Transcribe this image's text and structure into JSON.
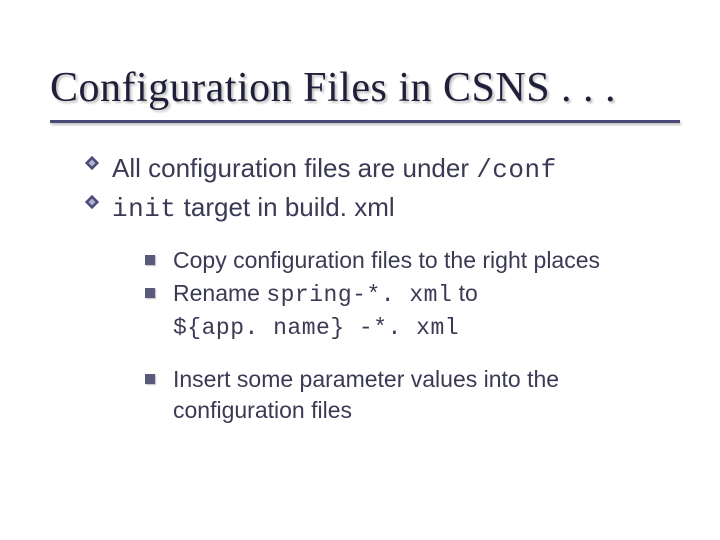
{
  "title": "Configuration Files in CSNS . . .",
  "bullets": {
    "l1": [
      {
        "pre": "All configuration files are under ",
        "code": "/conf",
        "post": ""
      },
      {
        "pre": "",
        "code": "init",
        "post": " target in build. xml"
      }
    ],
    "l2": [
      {
        "pre": "Copy configuration files to the right places",
        "code1": "",
        "mid": "",
        "code2": "",
        "post": ""
      },
      {
        "pre": "Rename ",
        "code1": "spring-*. xml",
        "mid": " to ",
        "code2": "${app. name} -*. xml",
        "post": ""
      },
      {
        "pre": "Insert some parameter values into the configuration files",
        "code1": "",
        "mid": "",
        "code2": "",
        "post": ""
      }
    ]
  }
}
